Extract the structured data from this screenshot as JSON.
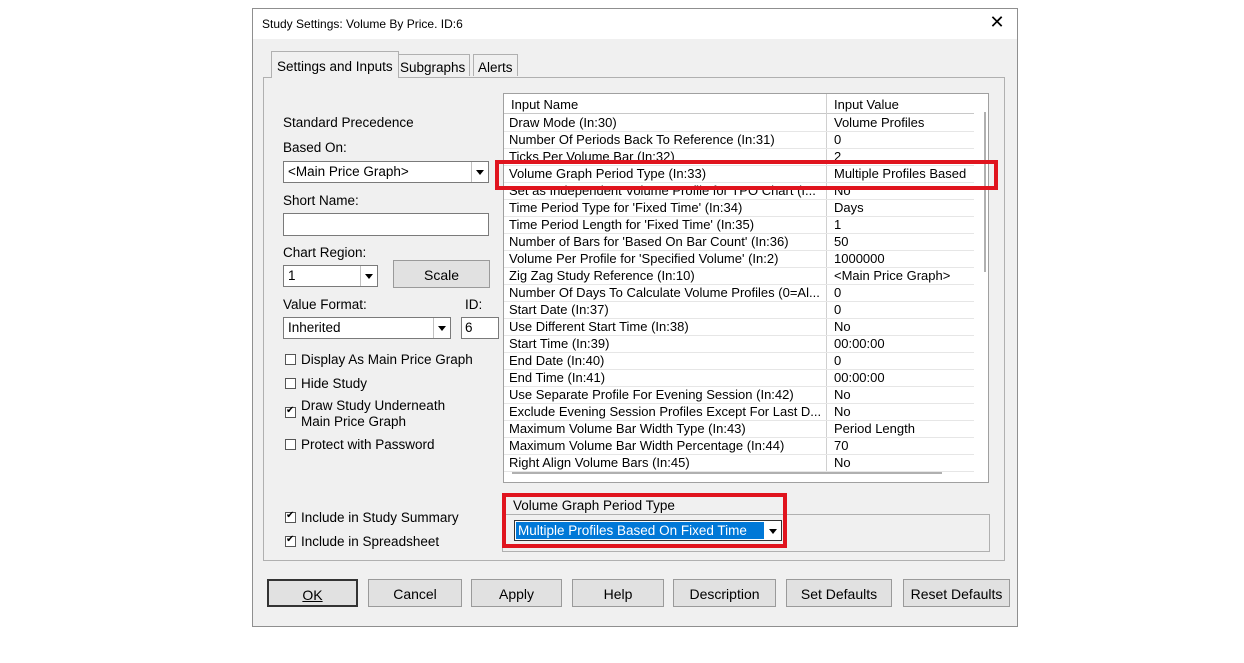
{
  "window": {
    "title": "Study Settings: Volume By Price. ID:6",
    "close_glyph": "✕"
  },
  "tabs": [
    {
      "label": "Settings and Inputs",
      "active": true
    },
    {
      "label": "Subgraphs",
      "active": false
    },
    {
      "label": "Alerts",
      "active": false
    }
  ],
  "left": {
    "standard_precedence": "Standard Precedence",
    "based_on_label": "Based On:",
    "based_on_value": "<Main Price Graph>",
    "short_name_label": "Short Name:",
    "short_name_value": "",
    "chart_region_label": "Chart Region:",
    "chart_region_value": "1",
    "scale_button": "Scale",
    "value_format_label": "Value Format:",
    "value_format_value": "Inherited",
    "id_label": "ID:",
    "id_value": "6",
    "checkboxes": [
      {
        "label": "Display As Main Price Graph",
        "checked": false
      },
      {
        "label": "Hide Study",
        "checked": false
      },
      {
        "label": "Draw Study Underneath",
        "label2": "Main Price Graph",
        "checked": true
      },
      {
        "label": "Protect with Password",
        "checked": false
      }
    ],
    "checkboxes_bottom": [
      {
        "label": "Include in Study Summary",
        "checked": true
      },
      {
        "label": "Include in Spreadsheet",
        "checked": true
      }
    ]
  },
  "grid": {
    "col_name": "Input Name",
    "col_value": "Input Value",
    "rows": [
      {
        "name": "Draw Mode  (In:30)",
        "value": "Volume Profiles"
      },
      {
        "name": "Number Of Periods Back To Reference  (In:31)",
        "value": "0"
      },
      {
        "name": "Ticks Per Volume Bar  (In:32)",
        "value": "2"
      },
      {
        "name": "Volume Graph Period Type  (In:33)",
        "value": "Multiple Profiles Based"
      },
      {
        "name": "Set as Independent Volume Profile for TPO Chart  (I...",
        "value": "No"
      },
      {
        "name": "Time Period Type for 'Fixed Time'  (In:34)",
        "value": "Days"
      },
      {
        "name": "Time Period Length for 'Fixed Time'  (In:35)",
        "value": "1"
      },
      {
        "name": "Number of Bars for 'Based On Bar Count'  (In:36)",
        "value": "50"
      },
      {
        "name": "Volume Per Profile for 'Specified Volume'  (In:2)",
        "value": "1000000"
      },
      {
        "name": "Zig Zag Study Reference  (In:10)",
        "value": "<Main Price Graph>"
      },
      {
        "name": "Number Of Days To Calculate Volume Profiles (0=Al...",
        "value": "0"
      },
      {
        "name": "Start Date  (In:37)",
        "value": "0"
      },
      {
        "name": "Use Different Start Time  (In:38)",
        "value": "No"
      },
      {
        "name": "Start Time  (In:39)",
        "value": "00:00:00"
      },
      {
        "name": "End Date  (In:40)",
        "value": "0"
      },
      {
        "name": "End Time  (In:41)",
        "value": "00:00:00"
      },
      {
        "name": "Use Separate Profile For Evening Session  (In:42)",
        "value": "No"
      },
      {
        "name": "Exclude Evening Session Profiles Except For Last D...",
        "value": "No"
      },
      {
        "name": "Maximum Volume Bar Width Type  (In:43)",
        "value": "Period Length"
      },
      {
        "name": "Maximum Volume Bar Width Percentage  (In:44)",
        "value": "70"
      },
      {
        "name": "Right Align Volume Bars  (In:45)",
        "value": "No"
      }
    ]
  },
  "editor": {
    "group_label": "Volume Graph Period Type",
    "selected_value": "Multiple Profiles Based On Fixed Time"
  },
  "buttons": {
    "ok": "OK",
    "cancel": "Cancel",
    "apply": "Apply",
    "help": "Help",
    "description": "Description",
    "set_defaults": "Set Defaults",
    "reset_defaults": "Reset Defaults"
  },
  "colors": {
    "highlight": "#e0141e",
    "selection": "#0078d7"
  }
}
